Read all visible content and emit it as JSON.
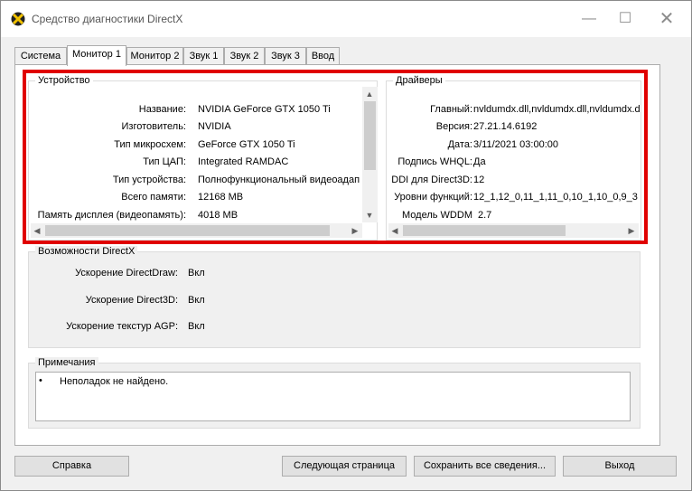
{
  "window": {
    "title": "Средство диагностики DirectX",
    "controls": {
      "minimize": "—",
      "maximize": "☐",
      "close": "✕"
    }
  },
  "tabs": [
    "Система",
    "Монитор 1",
    "Монитор 2",
    "Звук 1",
    "Звук 2",
    "Звук 3",
    "Ввод"
  ],
  "active_tab": "Монитор 1",
  "device": {
    "title": "Устройство",
    "rows": [
      {
        "label": "Название:",
        "value": "NVIDIA GeForce GTX 1050 Ti"
      },
      {
        "label": "Изготовитель:",
        "value": "NVIDIA"
      },
      {
        "label": "Тип микросхем:",
        "value": "GeForce GTX 1050 Ti"
      },
      {
        "label": "Тип ЦАП:",
        "value": "Integrated RAMDAC"
      },
      {
        "label": "Тип устройства:",
        "value": "Полнофункциональный видеоадап"
      },
      {
        "label": "Всего памяти:",
        "value": "12168 MB"
      },
      {
        "label": "Память дисплея (видеопамять):",
        "value": "4018 MB"
      }
    ]
  },
  "drivers": {
    "title": "Драйверы",
    "rows": [
      {
        "label": "Главный:",
        "value": "nvldumdx.dll,nvldumdx.dll,nvldumdx.d"
      },
      {
        "label": "Версия:",
        "value": "27.21.14.6192"
      },
      {
        "label": "Дата:",
        "value": "3/11/2021 03:00:00"
      },
      {
        "label": "Подпись WHQL:",
        "value": "Да"
      },
      {
        "label": "DDI для Direct3D:",
        "value": "12"
      },
      {
        "label": "Уровни функций:",
        "value": "12_1,12_0,11_1,11_0,10_1,10_0,9_3"
      },
      {
        "label": "Модель WDDM",
        "value": "2.7"
      }
    ]
  },
  "features": {
    "title": "Возможности DirectX",
    "rows": [
      {
        "label": "Ускорение DirectDraw:",
        "value": "Вкл"
      },
      {
        "label": "Ускорение Direct3D:",
        "value": "Вкл"
      },
      {
        "label": "Ускорение текстур AGP:",
        "value": "Вкл"
      }
    ]
  },
  "notes": {
    "title": "Примечания",
    "items": [
      "Неполадок не найдено."
    ]
  },
  "buttons": {
    "help": "Справка",
    "next_page": "Следующая страница",
    "save_all": "Сохранить все сведения...",
    "exit": "Выход"
  },
  "scroll_glyphs": {
    "up": "▲",
    "down": "▼",
    "left": "◀",
    "right": "▶"
  },
  "colors": {
    "highlight_frame": "#e00000"
  }
}
